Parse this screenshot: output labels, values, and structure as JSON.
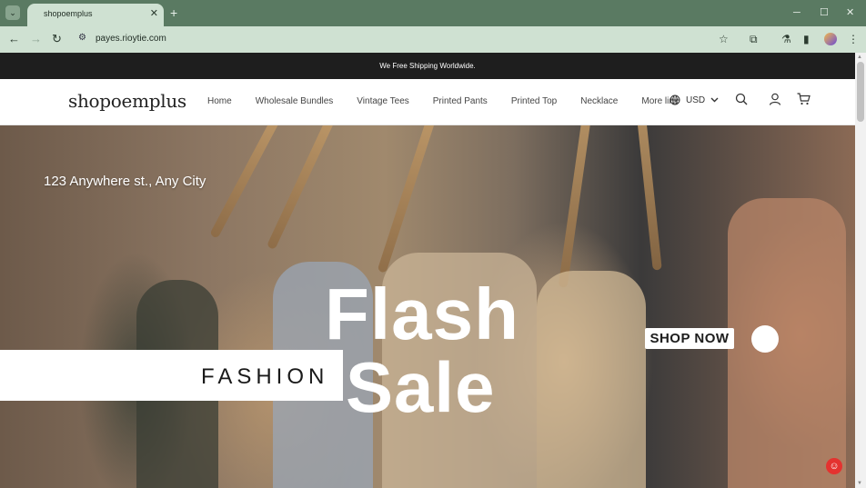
{
  "browser": {
    "tab_title": "shopoemplus",
    "tab_close": "✕",
    "new_tab": "+",
    "url": "payes.rioytie.com",
    "icons": [
      "tab-search-icon",
      "back-icon",
      "forward-icon",
      "reload-icon",
      "site-info-icon",
      "bookmark-star-icon",
      "extensions-icon",
      "labs-icon",
      "side-panel-icon",
      "profile-icon",
      "menu-icon",
      "minimize-icon",
      "maximize-icon",
      "close-window-icon"
    ]
  },
  "announcement": "We Free Shipping Worldwide.",
  "header": {
    "logo": "shopoemplus",
    "nav": [
      "Home",
      "Wholesale Bundles",
      "Vintage Tees",
      "Printed Pants",
      "Printed Top",
      "Necklace",
      "More link"
    ],
    "currency": "USD",
    "icons": [
      "globe-icon",
      "chevron-down-icon",
      "search-icon",
      "account-icon",
      "cart-icon"
    ]
  },
  "hero": {
    "address": "123 Anywhere st., Any City",
    "headline_1": "Flash",
    "headline_2": "Sale",
    "band_text": "FASHION",
    "cta": "SHOP NOW"
  },
  "colors": {
    "chrome": "#5a7a62",
    "toolbar": "#cfe1d2",
    "announcement_bg": "#1e1e1e",
    "chat_badge": "#e4322f"
  }
}
